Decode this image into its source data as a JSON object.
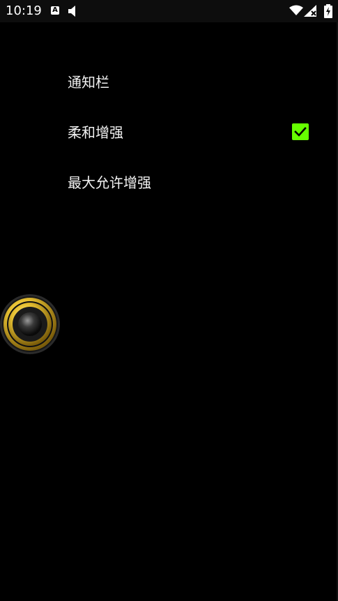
{
  "status_bar": {
    "time": "10:19",
    "a_badge": "A",
    "icons": [
      "a-icon",
      "volume-icon",
      "wifi-icon",
      "signal-icon",
      "battery-icon"
    ]
  },
  "menu": {
    "items": [
      {
        "label": "通知栏"
      },
      {
        "label": "柔和增强"
      },
      {
        "label": "最大允许增强"
      }
    ]
  },
  "colors": {
    "background": "#000000",
    "checkbox_accent": "#66ff00",
    "knob_gold": "#d4af37"
  },
  "soft_boost_checked": true
}
